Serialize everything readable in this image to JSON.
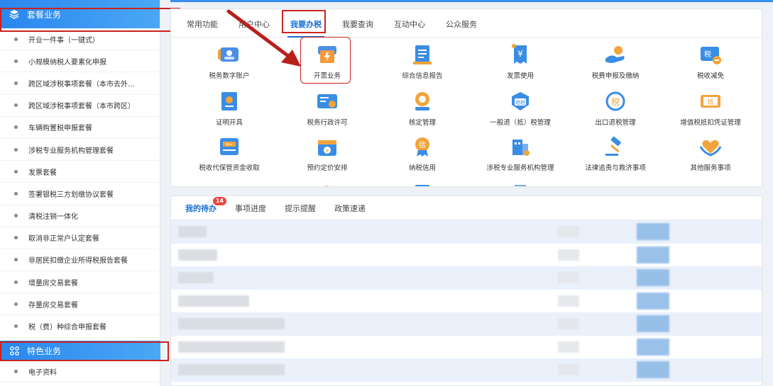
{
  "sidebar": {
    "header1": "套餐业务",
    "items": [
      {
        "label": "开业一件事（一键式）"
      },
      {
        "label": "小规模纳税人要素化申报"
      },
      {
        "label": "跨区域涉税事项套餐（本市去外…"
      },
      {
        "label": "跨区域涉税事项套餐（本市跨区）"
      },
      {
        "label": "车辆购置税申报套餐"
      },
      {
        "label": "涉税专业服务机构管理套餐"
      },
      {
        "label": "发票套餐"
      },
      {
        "label": "签署银税三方划缴协议套餐"
      },
      {
        "label": "清税注销一体化"
      },
      {
        "label": "取消非正常户认定套餐"
      },
      {
        "label": "非居民扣缴企业所得税报告套餐"
      },
      {
        "label": "增量房交易套餐"
      },
      {
        "label": "存量房交易套餐"
      },
      {
        "label": "税（费）种综合申报套餐"
      }
    ],
    "header2": "特色业务",
    "tail_items": [
      {
        "label": "电子资料"
      }
    ]
  },
  "main": {
    "tabs": [
      {
        "label": "常用功能"
      },
      {
        "label": "用户中心"
      },
      {
        "label": "我要办税",
        "active": true
      },
      {
        "label": "我要查询"
      },
      {
        "label": "互动中心"
      },
      {
        "label": "公众服务"
      }
    ],
    "services": [
      {
        "label": "税务数字账户",
        "icon": "digital-account-icon"
      },
      {
        "label": "开票业务",
        "icon": "invoice-issue-icon"
      },
      {
        "label": "综合信息报告",
        "icon": "report-icon"
      },
      {
        "label": "发票使用",
        "icon": "invoice-use-icon"
      },
      {
        "label": "税费申报及缴纳",
        "icon": "tax-payment-icon"
      },
      {
        "label": "税收减免",
        "icon": "tax-reduction-icon"
      },
      {
        "label": "证明开具",
        "icon": "certificate-icon"
      },
      {
        "label": "税务行政许可",
        "icon": "license-icon"
      },
      {
        "label": "核定管理",
        "icon": "approval-icon"
      },
      {
        "label": "一般退（抵）税管理",
        "icon": "refund-icon"
      },
      {
        "label": "出口退税管理",
        "icon": "export-refund-icon"
      },
      {
        "label": "增值税抵扣凭证管理",
        "icon": "vat-deduction-icon"
      },
      {
        "label": "税收代保管资金收取",
        "icon": "fund-custody-icon"
      },
      {
        "label": "预约定价安排",
        "icon": "calendar-icon"
      },
      {
        "label": "纳税信用",
        "icon": "credit-icon"
      },
      {
        "label": "涉税专业服务机构管理",
        "icon": "agency-icon"
      },
      {
        "label": "法律追责与救济事项",
        "icon": "gavel-icon"
      },
      {
        "label": "其他服务事项",
        "icon": "heart-hands-icon"
      }
    ]
  },
  "panel2": {
    "tabs": [
      {
        "label": "我的待办",
        "badge": "14",
        "active": true
      },
      {
        "label": "事项进度"
      },
      {
        "label": "提示提醒"
      },
      {
        "label": "政策速递"
      }
    ]
  },
  "colors": {
    "accent": "#1a6fd4",
    "sidebar_header": "#2b86ee",
    "annotation_red": "#c8231e",
    "badge": "#e8483f"
  }
}
